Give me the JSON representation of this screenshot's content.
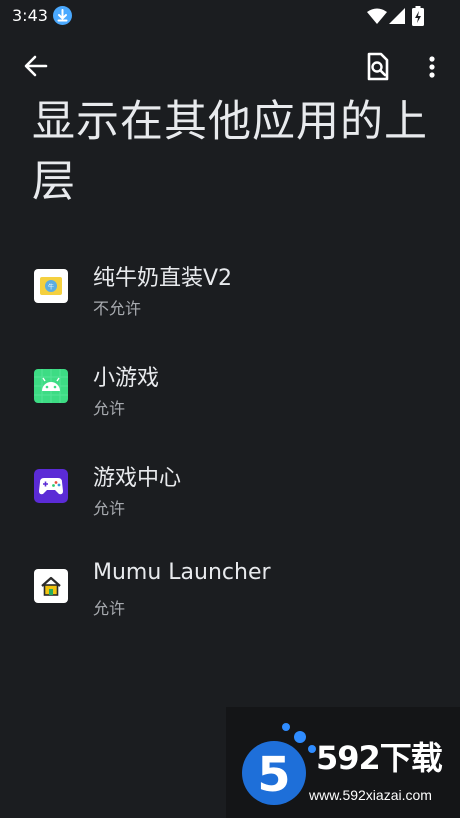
{
  "status_bar": {
    "time": "3:43"
  },
  "header": {
    "title": "显示在其他应用的上层"
  },
  "apps": [
    {
      "name": "纯牛奶直装V2",
      "status": "不允许"
    },
    {
      "name": "小游戏",
      "status": "允许"
    },
    {
      "name": "游戏中心",
      "status": "允许"
    },
    {
      "name": "Mumu Launcher",
      "status": "允许"
    }
  ],
  "watermark": {
    "brand": "592下载",
    "url": "www.592xiazai.com"
  },
  "colors": {
    "background": "#1b1d20",
    "text_primary": "#e8eaed",
    "text_secondary": "#a8abb0",
    "accent": "#4aa9ff"
  },
  "icons": {
    "back": "arrow-left-icon",
    "search": "page-search-icon",
    "more": "more-vertical-icon"
  }
}
